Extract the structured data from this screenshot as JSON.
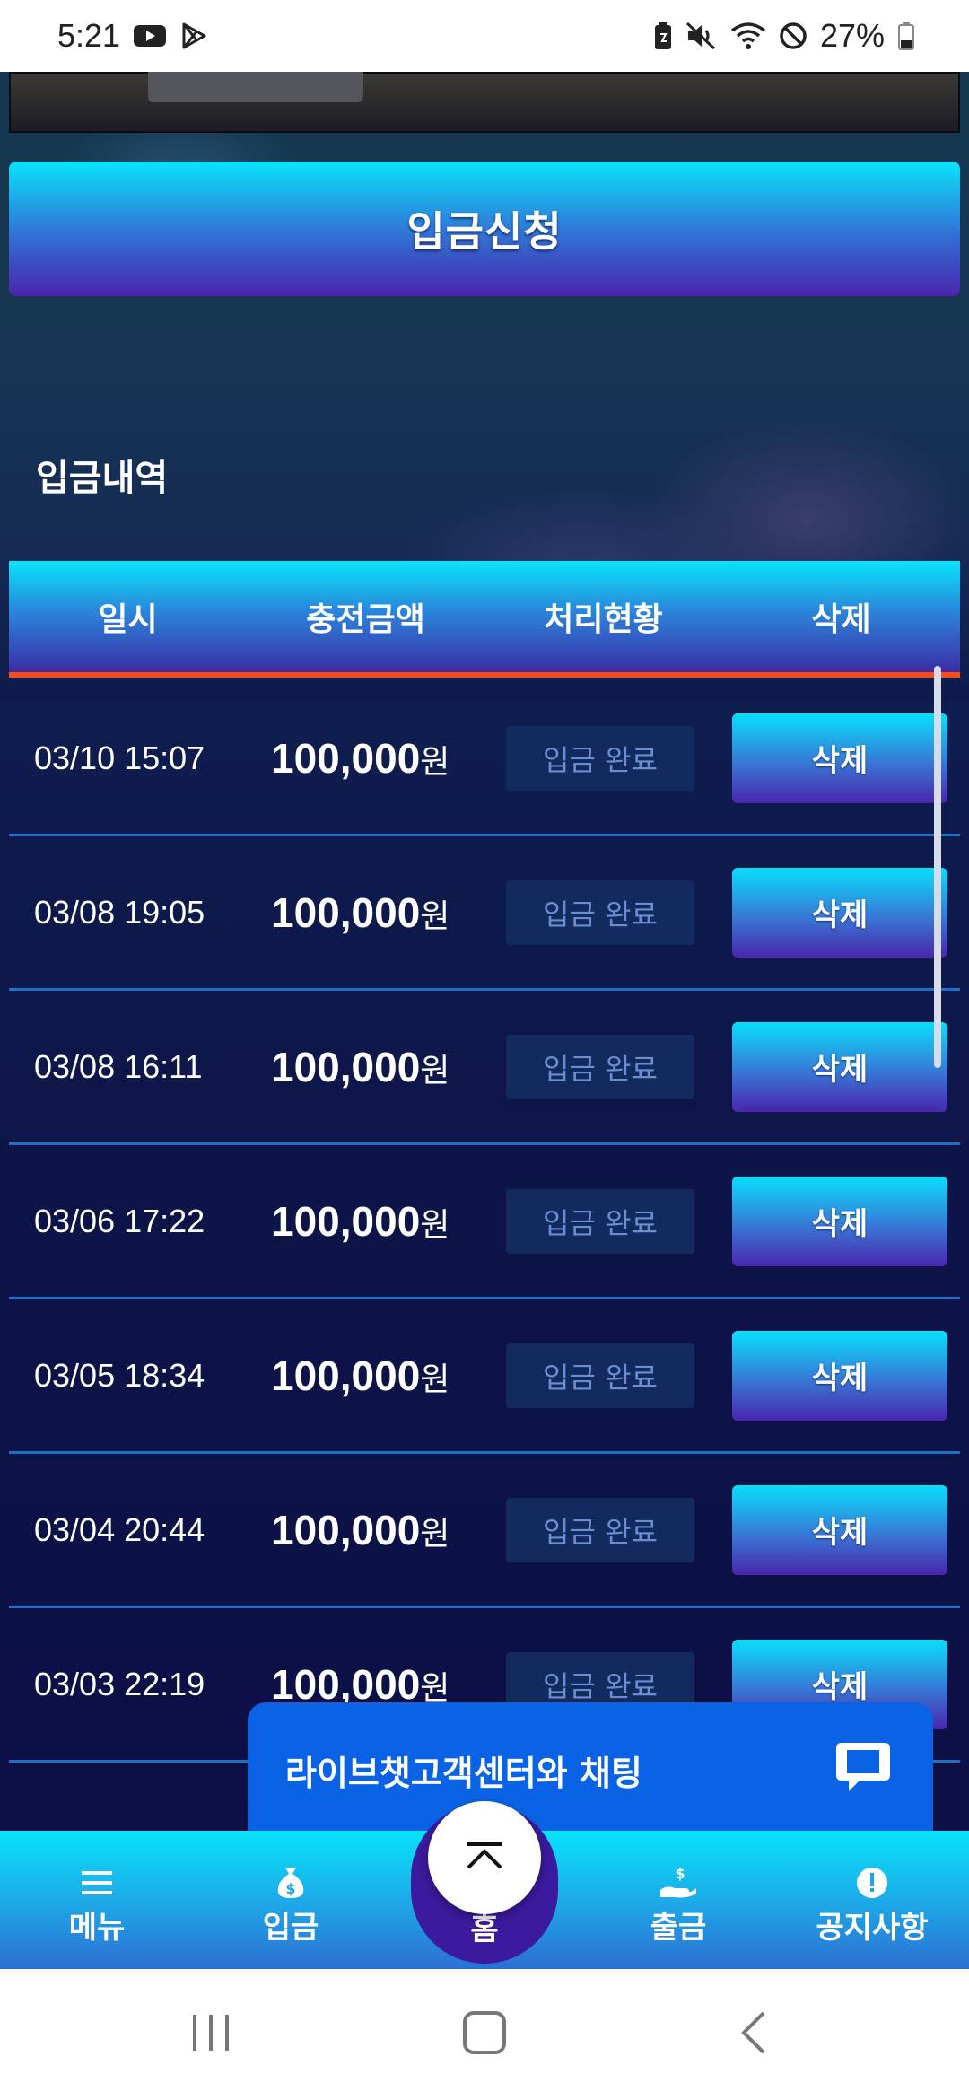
{
  "status_bar": {
    "time": "5:21",
    "battery": "27%",
    "icons": [
      "youtube-icon",
      "play-store-icon",
      "battery-saver-icon",
      "mute-icon",
      "wifi-icon",
      "dnd-icon",
      "battery-icon"
    ]
  },
  "deposit_request_label": "입금신청",
  "section_title": "입금내역",
  "table": {
    "headers": [
      "일시",
      "충전금액",
      "처리현황",
      "삭제"
    ],
    "currency_suffix": "원",
    "rows": [
      {
        "date": "03/10 15:07",
        "amount": "100,000",
        "status": "입금 완료",
        "delete": "삭제"
      },
      {
        "date": "03/08 19:05",
        "amount": "100,000",
        "status": "입금 완료",
        "delete": "삭제"
      },
      {
        "date": "03/08 16:11",
        "amount": "100,000",
        "status": "입금 완료",
        "delete": "삭제"
      },
      {
        "date": "03/06 17:22",
        "amount": "100,000",
        "status": "입금 완료",
        "delete": "삭제"
      },
      {
        "date": "03/05 18:34",
        "amount": "100,000",
        "status": "입금 완료",
        "delete": "삭제"
      },
      {
        "date": "03/04 20:44",
        "amount": "100,000",
        "status": "입금 완료",
        "delete": "삭제"
      },
      {
        "date": "03/03 22:19",
        "amount": "100,000",
        "status": "입금 완료",
        "delete": "삭제"
      }
    ]
  },
  "chat_banner": {
    "label": "라이브챗고객센터와 채팅",
    "icon": "chat-bubble-icon"
  },
  "bottom_nav": {
    "items": [
      {
        "label": "메뉴",
        "icon": "menu-icon"
      },
      {
        "label": "입금",
        "icon": "money-bag-icon"
      },
      {
        "label": "홈",
        "icon": "home-icon"
      },
      {
        "label": "출금",
        "icon": "hand-coin-icon"
      },
      {
        "label": "공지사항",
        "icon": "info-icon"
      }
    ],
    "scroll_top_icon": "chevron-up-icon"
  },
  "colors": {
    "accent_cyan": "#08e4fb",
    "accent_purple": "#4a24ad",
    "header_underline": "#ff4b12",
    "chat_blue": "#0a63e5",
    "page_bg": "#0d0f45"
  }
}
